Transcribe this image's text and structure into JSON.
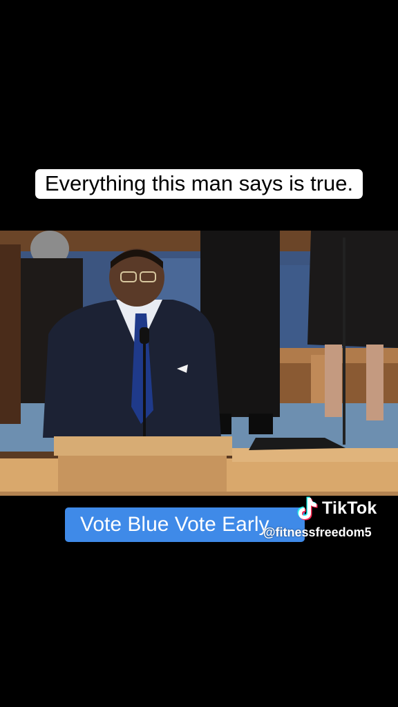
{
  "caption_top": "Everything this man says is true.",
  "caption_bottom": "Vote Blue Vote Early",
  "watermark": {
    "brand": "TikTok",
    "handle": "@fitnessfreedom5",
    "icon": "tiktok-note-icon"
  },
  "colors": {
    "background": "#000000",
    "caption_top_bg": "#ffffff",
    "caption_bottom_bg": "#3f8ae8",
    "tiktok_cyan": "#25f4ee",
    "tiktok_red": "#fe2c55"
  }
}
